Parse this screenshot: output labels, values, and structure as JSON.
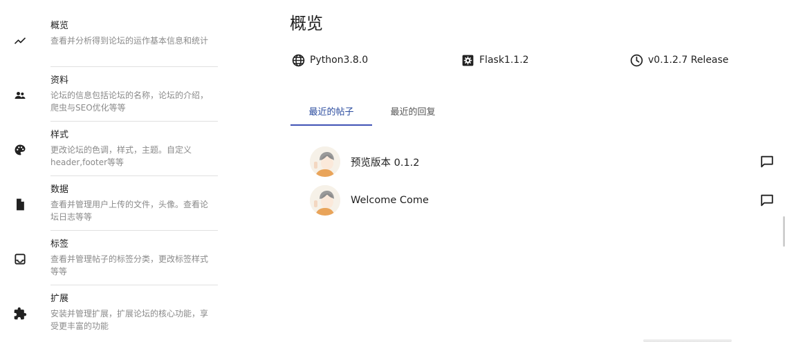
{
  "sidebar": {
    "items": [
      {
        "title": "概览",
        "desc": "查看并分析得到论坛的运作基本信息和统计",
        "icon": "trending-icon"
      },
      {
        "title": "资料",
        "desc": "论坛的信息包括论坛的名称，论坛的介绍，爬虫与SEO优化等等",
        "icon": "people-icon"
      },
      {
        "title": "样式",
        "desc": "更改论坛的色调，样式，主题。自定义header,footer等等",
        "icon": "palette-icon"
      },
      {
        "title": "数据",
        "desc": "查看并管理用户上传的文件，头像。查看论坛日志等等",
        "icon": "file-icon"
      },
      {
        "title": "标签",
        "desc": "查看并管理帖子的标签分类，更改标签样式等等",
        "icon": "inbox-icon"
      },
      {
        "title": "扩展",
        "desc": "安装并管理扩展，扩展论坛的核心功能，享受更丰富的功能",
        "icon": "puzzle-icon"
      }
    ]
  },
  "main": {
    "title": "概览",
    "info": {
      "python": "Python3.8.0",
      "flask": "Flask1.1.2",
      "version": "v0.1.2.7 Release"
    },
    "tabs": [
      {
        "label": "最近的帖子",
        "active": true
      },
      {
        "label": "最近的回复",
        "active": false
      }
    ],
    "posts": [
      {
        "title": "预览版本 0.1.2"
      },
      {
        "title": "Welcome Come"
      }
    ]
  },
  "colors": {
    "accent": "#3f51b5",
    "tab_active_text": "#2b4c9f",
    "muted_text": "#8a8a8a",
    "divider": "#e0e0e0"
  }
}
